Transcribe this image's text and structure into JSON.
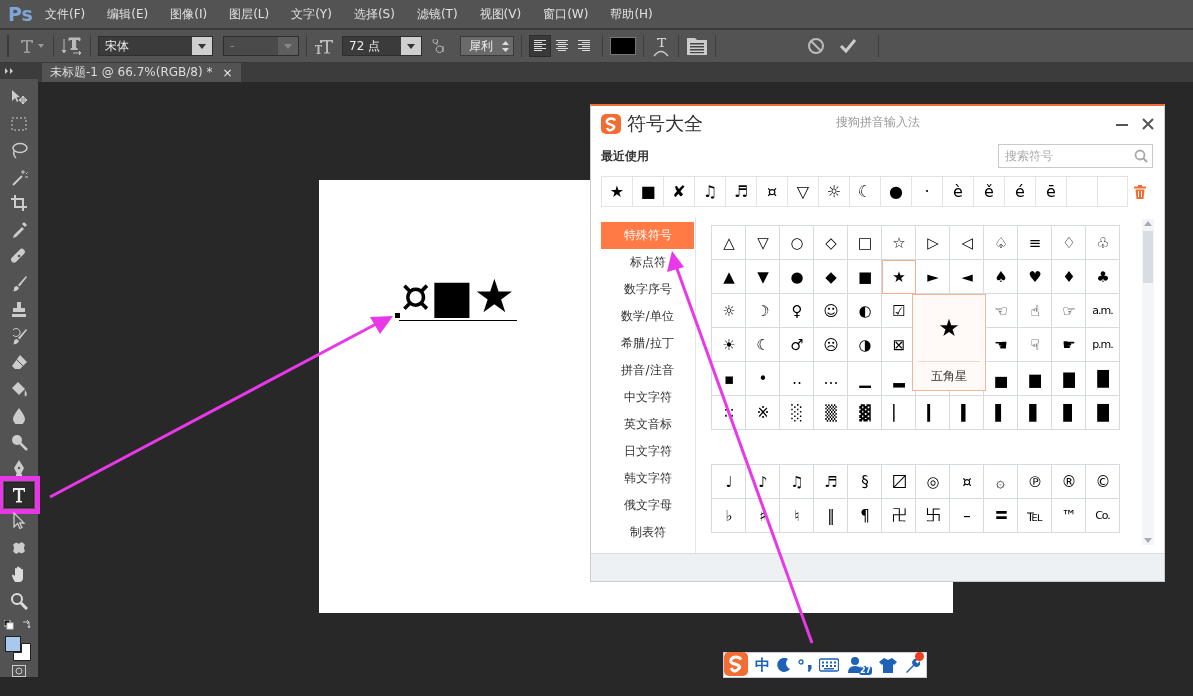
{
  "app": {
    "logo": "Ps",
    "menus": [
      "文件(F)",
      "编辑(E)",
      "图像(I)",
      "图层(L)",
      "文字(Y)",
      "选择(S)",
      "滤镜(T)",
      "视图(V)",
      "窗口(W)",
      "帮助(H)"
    ]
  },
  "options_bar": {
    "font_family": "宋体",
    "font_style": "-",
    "font_size": "72 点",
    "antialias": "犀利",
    "alignment": [
      {
        "kind": "left",
        "selected": true
      },
      {
        "kind": "center",
        "selected": false
      },
      {
        "kind": "right",
        "selected": false
      }
    ]
  },
  "document_tab": {
    "title": "未标题-1 @ 66.7%(RGB/8) *",
    "close": "×"
  },
  "tools": [
    {
      "kind": "move",
      "selected": false,
      "highlighted": false
    },
    {
      "kind": "marquee",
      "selected": false,
      "highlighted": false
    },
    {
      "kind": "lasso",
      "selected": false,
      "highlighted": false
    },
    {
      "kind": "wand",
      "selected": false,
      "highlighted": false
    },
    {
      "kind": "crop",
      "selected": false,
      "highlighted": false
    },
    {
      "kind": "eyedropper",
      "selected": false,
      "highlighted": false
    },
    {
      "kind": "healing",
      "selected": false,
      "highlighted": false
    },
    {
      "kind": "brush",
      "selected": false,
      "highlighted": false
    },
    {
      "kind": "stamp",
      "selected": false,
      "highlighted": false
    },
    {
      "kind": "history",
      "selected": false,
      "highlighted": false
    },
    {
      "kind": "eraser",
      "selected": false,
      "highlighted": false
    },
    {
      "kind": "bucket",
      "selected": false,
      "highlighted": false
    },
    {
      "kind": "blur",
      "selected": false,
      "highlighted": false
    },
    {
      "kind": "dodge",
      "selected": false,
      "highlighted": false
    },
    {
      "kind": "pen",
      "selected": false,
      "highlighted": false
    },
    {
      "kind": "type",
      "selected": true,
      "highlighted": true
    },
    {
      "kind": "path",
      "selected": false,
      "highlighted": false
    },
    {
      "kind": "shape",
      "selected": false,
      "highlighted": false
    },
    {
      "kind": "hand",
      "selected": false,
      "highlighted": false
    },
    {
      "kind": "zoom",
      "selected": false,
      "highlighted": false
    }
  ],
  "canvas": {
    "text": "¤■★"
  },
  "symbol_dialog": {
    "title": "符号大全",
    "subtitle": "搜狗拼音输入法",
    "recent_label": "最近使用",
    "search": {
      "placeholder": "搜索符号"
    },
    "recent": [
      "★",
      "■",
      "✘",
      "♫",
      "♬",
      "¤",
      "▽",
      "☼",
      "☾",
      "●",
      "·",
      "è",
      "ě",
      "é",
      "ē"
    ],
    "categories": [
      {
        "label": "特殊符号",
        "selected": true
      },
      {
        "label": "标点符",
        "selected": false
      },
      {
        "label": "数字序号",
        "selected": false
      },
      {
        "label": "数学/单位",
        "selected": false
      },
      {
        "label": "希腊/拉丁",
        "selected": false
      },
      {
        "label": "拼音/注音",
        "selected": false
      },
      {
        "label": "中文字符",
        "selected": false
      },
      {
        "label": "英文音标",
        "selected": false
      },
      {
        "label": "日文字符",
        "selected": false
      },
      {
        "label": "韩文字符",
        "selected": false
      },
      {
        "label": "俄文字母",
        "selected": false
      },
      {
        "label": "制表符",
        "selected": false
      }
    ],
    "grid": [
      [
        {
          "symbol": "△",
          "selected": false
        },
        {
          "symbol": "▽",
          "selected": false
        },
        {
          "symbol": "○",
          "selected": false
        },
        {
          "symbol": "◇",
          "selected": false
        },
        {
          "symbol": "□",
          "selected": false
        },
        {
          "symbol": "☆",
          "selected": false
        },
        {
          "symbol": "▷",
          "selected": false
        },
        {
          "symbol": "◁",
          "selected": false
        },
        {
          "symbol": "♤",
          "selected": false
        },
        {
          "symbol": "≡",
          "selected": false
        },
        {
          "symbol": "♢",
          "selected": false
        },
        {
          "symbol": "♧",
          "selected": false
        }
      ],
      [
        {
          "symbol": "▲",
          "selected": false
        },
        {
          "symbol": "▼",
          "selected": false
        },
        {
          "symbol": "●",
          "selected": false
        },
        {
          "symbol": "◆",
          "selected": false
        },
        {
          "symbol": "■",
          "selected": false
        },
        {
          "symbol": "★",
          "selected": true
        },
        {
          "symbol": "►",
          "selected": false
        },
        {
          "symbol": "◄",
          "selected": false
        },
        {
          "symbol": "♠",
          "selected": false
        },
        {
          "symbol": "♥",
          "selected": false
        },
        {
          "symbol": "♦",
          "selected": false
        },
        {
          "symbol": "♣",
          "selected": false
        }
      ],
      [
        {
          "symbol": "☼",
          "selected": false
        },
        {
          "symbol": "☽",
          "selected": false
        },
        {
          "symbol": "♀",
          "selected": false
        },
        {
          "symbol": "☺",
          "selected": false
        },
        {
          "symbol": "◐",
          "selected": false
        },
        {
          "symbol": "☑",
          "selected": false
        },
        {
          "symbol": "☜",
          "selected": false
        },
        {
          "symbol": "☝",
          "selected": false
        },
        {
          "symbol": "☞",
          "selected": false
        },
        {
          "symbol": "a.m.",
          "selected": false
        }
      ],
      [
        {
          "symbol": "☀",
          "selected": false
        },
        {
          "symbol": "☾",
          "selected": false
        },
        {
          "symbol": "♂",
          "selected": false
        },
        {
          "symbol": "☹",
          "selected": false
        },
        {
          "symbol": "◑",
          "selected": false
        },
        {
          "symbol": "⊠",
          "selected": false
        },
        {
          "symbol": "☚",
          "selected": false
        },
        {
          "symbol": "☟",
          "selected": false
        },
        {
          "symbol": "☛",
          "selected": false
        },
        {
          "symbol": "p.m.",
          "selected": false
        }
      ],
      [
        {
          "symbol": "▪",
          "selected": false
        },
        {
          "symbol": "•",
          "selected": false
        },
        {
          "symbol": "‥",
          "selected": false
        },
        {
          "symbol": "…",
          "selected": false
        },
        {
          "symbol": "▁",
          "selected": false
        },
        {
          "symbol": "▂",
          "selected": false
        },
        {
          "symbol": "▅",
          "selected": false
        },
        {
          "symbol": "▆",
          "selected": false
        },
        {
          "symbol": "▇",
          "selected": false
        },
        {
          "symbol": "█",
          "selected": false
        }
      ],
      [
        {
          "symbol": "∷",
          "selected": false
        },
        {
          "symbol": "※",
          "selected": false
        },
        {
          "symbol": "░",
          "selected": false
        },
        {
          "symbol": "▒",
          "selected": false
        },
        {
          "symbol": "▓",
          "selected": false
        },
        {
          "symbol": "▏",
          "selected": false
        },
        {
          "symbol": "▎",
          "selected": false
        },
        {
          "symbol": "▍",
          "selected": false
        },
        {
          "symbol": "▌",
          "selected": false
        },
        {
          "symbol": "▋",
          "selected": false
        },
        {
          "symbol": "▊",
          "selected": false
        },
        {
          "symbol": "█",
          "selected": false
        }
      ]
    ],
    "grid_2": [
      [
        {
          "symbol": "♩",
          "selected": false
        },
        {
          "symbol": "♪",
          "selected": false
        },
        {
          "symbol": "♫",
          "selected": false
        },
        {
          "symbol": "♬",
          "selected": false
        },
        {
          "symbol": "§",
          "selected": false
        },
        {
          "symbol": "〼",
          "selected": false
        },
        {
          "symbol": "◎",
          "selected": false
        },
        {
          "symbol": "¤",
          "selected": false
        },
        {
          "symbol": "۞",
          "selected": false
        },
        {
          "symbol": "℗",
          "selected": false
        },
        {
          "symbol": "®",
          "selected": false
        },
        {
          "symbol": "©",
          "selected": false
        }
      ],
      [
        {
          "symbol": "♭",
          "selected": false
        },
        {
          "symbol": "♯",
          "selected": false
        },
        {
          "symbol": "♮",
          "selected": false
        },
        {
          "symbol": "‖",
          "selected": false
        },
        {
          "symbol": "¶",
          "selected": false
        },
        {
          "symbol": "卍",
          "selected": false
        },
        {
          "symbol": "卐",
          "selected": false
        },
        {
          "symbol": "–",
          "selected": false
        },
        {
          "symbol": "〓",
          "selected": false
        },
        {
          "symbol": "℡",
          "selected": false
        },
        {
          "symbol": "™",
          "selected": false
        },
        {
          "symbol": "Co.",
          "selected": false
        }
      ]
    ],
    "tooltip": {
      "symbol": "★",
      "name": "五角星"
    }
  },
  "ime_bar": {
    "mode": "中",
    "badge": "27"
  }
}
